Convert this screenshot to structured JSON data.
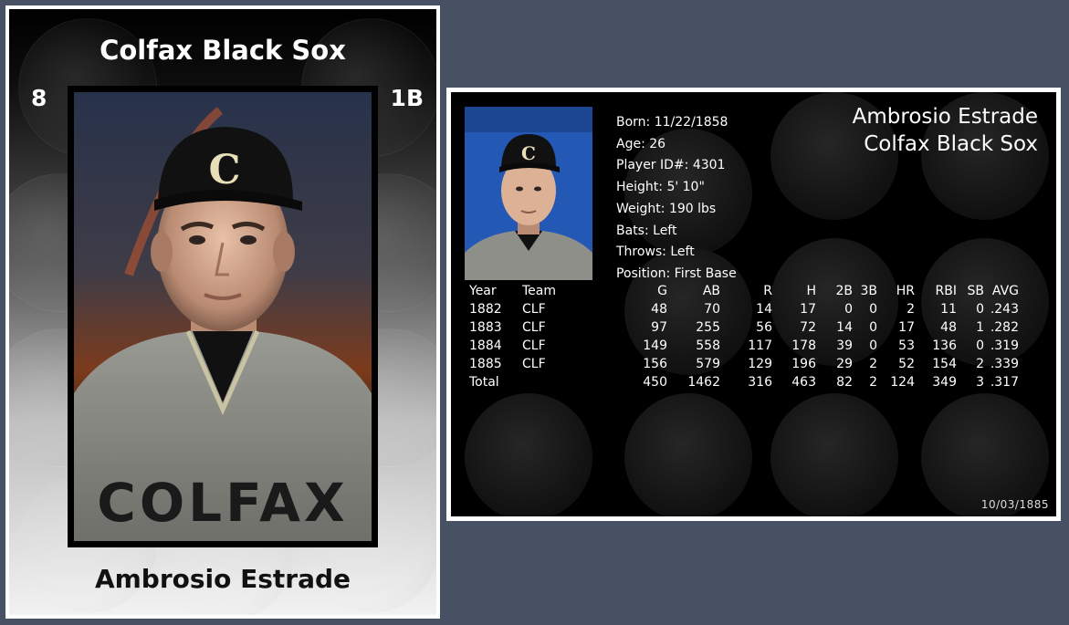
{
  "front_card": {
    "team_name": "Colfax Black Sox",
    "number": "8",
    "position": "1B",
    "player_name": "Ambrosio Estrade",
    "portrait": "player-portrait",
    "jersey_text": "COLFAX",
    "cap_letter": "C"
  },
  "back_card": {
    "player_name": "Ambrosio Estrade",
    "team_name": "Colfax Black Sox",
    "thumbnail": "player-thumbnail",
    "info": {
      "born": "Born: 11/22/1858",
      "age": "Age: 26",
      "player_id": "Player ID#: 4301",
      "height": "Height: 5' 10\"",
      "weight": "Weight: 190 lbs",
      "bats": "Bats: Left",
      "throws": "Throws: Left",
      "position": "Position: First Base"
    },
    "stats": {
      "headers": [
        "Year",
        "Team",
        "G",
        "AB",
        "R",
        "H",
        "2B",
        "3B",
        "HR",
        "RBI",
        "SB",
        "AVG"
      ],
      "rows": [
        [
          "1882",
          "CLF",
          "48",
          "70",
          "14",
          "17",
          "0",
          "0",
          "2",
          "11",
          "0",
          ".243"
        ],
        [
          "1883",
          "CLF",
          "97",
          "255",
          "56",
          "72",
          "14",
          "0",
          "17",
          "48",
          "1",
          ".282"
        ],
        [
          "1884",
          "CLF",
          "149",
          "558",
          "117",
          "178",
          "39",
          "0",
          "53",
          "136",
          "0",
          ".319"
        ],
        [
          "1885",
          "CLF",
          "156",
          "579",
          "129",
          "196",
          "29",
          "2",
          "52",
          "154",
          "2",
          ".339"
        ],
        [
          "Total",
          "",
          "450",
          "1462",
          "316",
          "463",
          "82",
          "2",
          "124",
          "349",
          "3",
          ".317"
        ]
      ]
    },
    "date": "10/03/1885"
  },
  "colors": {
    "page_background": "#475163",
    "card_border": "#ffffff",
    "back_background": "#000000"
  }
}
